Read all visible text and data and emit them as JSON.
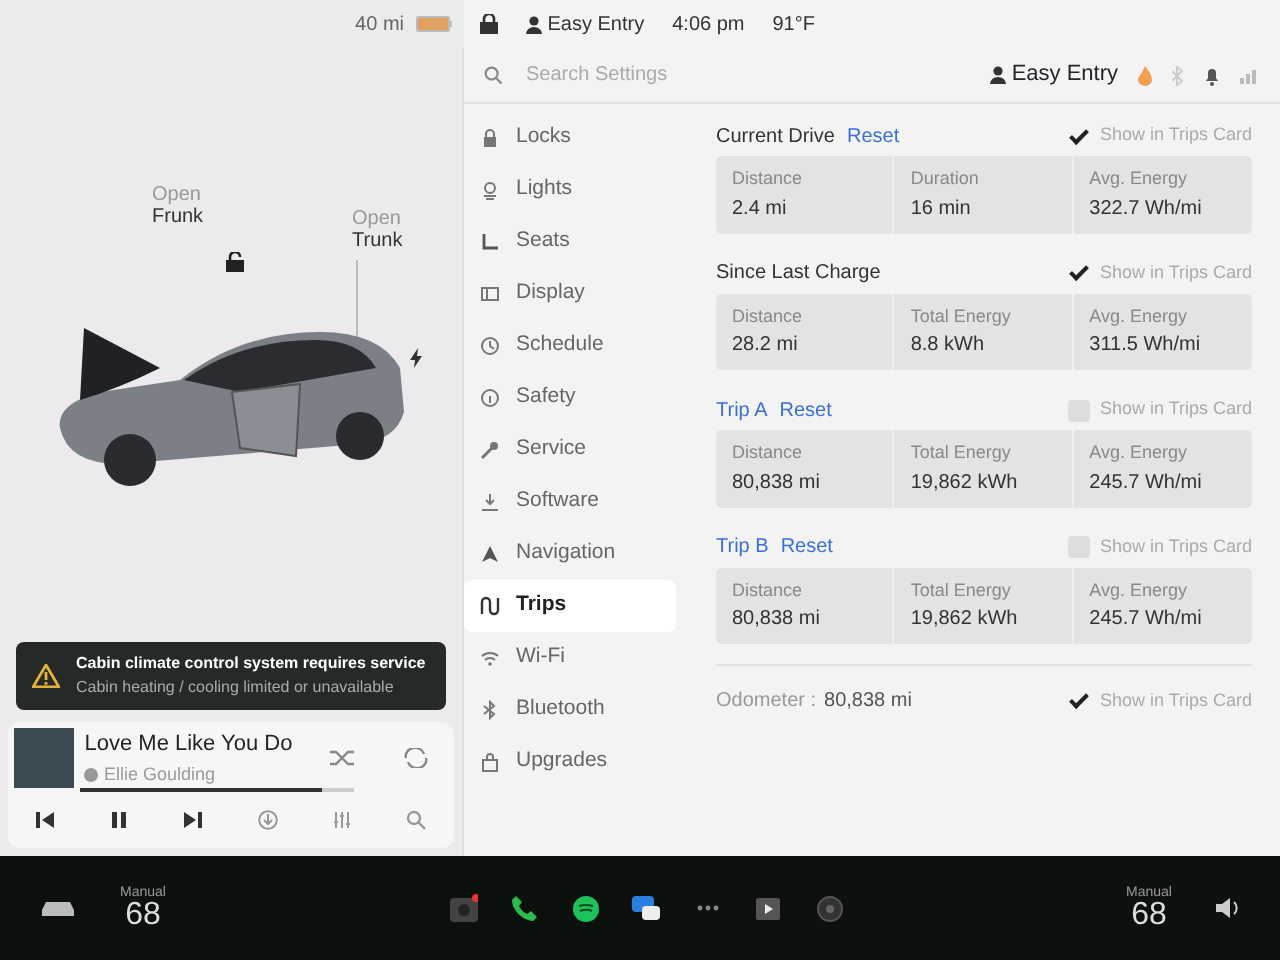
{
  "status_bar": {
    "range": "40 mi",
    "profile": "Easy Entry",
    "time": "4:06 pm",
    "temperature": "91°F"
  },
  "car_panel": {
    "callouts": [
      {
        "action": "Open",
        "part": "Frunk"
      },
      {
        "action": "Open",
        "part": "Trunk"
      }
    ],
    "alert": {
      "title": "Cabin climate control system requires service",
      "detail": "Cabin heating / cooling limited or unavailable"
    }
  },
  "media": {
    "title": "Love Me Like You Do",
    "artist": "Ellie Goulding",
    "level": 0.88
  },
  "settings": {
    "search": {
      "placeholder": "Search Settings"
    },
    "profile": "Easy Entry",
    "menu": [
      {
        "label": "Locks",
        "selected": false
      },
      {
        "label": "Lights",
        "selected": false
      },
      {
        "label": "Seats",
        "selected": false
      },
      {
        "label": "Display",
        "selected": false
      },
      {
        "label": "Schedule",
        "selected": false
      },
      {
        "label": "Safety",
        "selected": false
      },
      {
        "label": "Service",
        "selected": false
      },
      {
        "label": "Software",
        "selected": false
      },
      {
        "label": "Navigation",
        "selected": false
      },
      {
        "label": "Trips",
        "selected": true
      },
      {
        "label": "Wi-Fi",
        "selected": false
      },
      {
        "label": "Bluetooth",
        "selected": false
      },
      {
        "label": "Upgrades",
        "selected": false
      }
    ]
  },
  "trips": [
    {
      "title": "Current Drive",
      "reset": "Reset",
      "show_in_trips_card": {
        "label": "Show in Trips Card",
        "checked": true
      },
      "stats": [
        {
          "label": "Distance",
          "value": "2.4 mi"
        },
        {
          "label": "Duration",
          "value": "16 min"
        },
        {
          "label": "Avg. Energy",
          "value": "322.7 Wh/mi"
        }
      ]
    },
    {
      "title": "Since Last Charge",
      "show_in_trips_card": {
        "label": "Show in Trips Card",
        "checked": true
      },
      "stats": [
        {
          "label": "Distance",
          "value": "28.2 mi"
        },
        {
          "label": "Total Energy",
          "value": "8.8 kWh"
        },
        {
          "label": "Avg. Energy",
          "value": "311.5 Wh/mi"
        }
      ]
    },
    {
      "title": "Trip A",
      "reset": "Reset",
      "show_in_trips_card": {
        "label": "Show in Trips Card",
        "checked": false
      },
      "stats": [
        {
          "label": "Distance",
          "value": "80,838 mi"
        },
        {
          "label": "Total Energy",
          "value": "19,862 kWh"
        },
        {
          "label": "Avg. Energy",
          "value": "245.7 Wh/mi"
        }
      ]
    },
    {
      "title": "Trip B",
      "reset": "Reset",
      "show_in_trips_card": {
        "label": "Show in Trips Card",
        "checked": false
      },
      "stats": [
        {
          "label": "Distance",
          "value": "80,838 mi"
        },
        {
          "label": "Total Energy",
          "value": "19,862 kWh"
        },
        {
          "label": "Avg. Energy",
          "value": "245.7 Wh/mi"
        }
      ]
    }
  ],
  "odometer": {
    "label": "Odometer :",
    "value": "80,838 mi",
    "show_in_trips_card": {
      "label": "Show in Trips Card",
      "checked": true
    }
  },
  "dock": {
    "left_temp": {
      "mode": "Manual",
      "value": "68"
    },
    "right_temp": {
      "mode": "Manual",
      "value": "68"
    }
  }
}
